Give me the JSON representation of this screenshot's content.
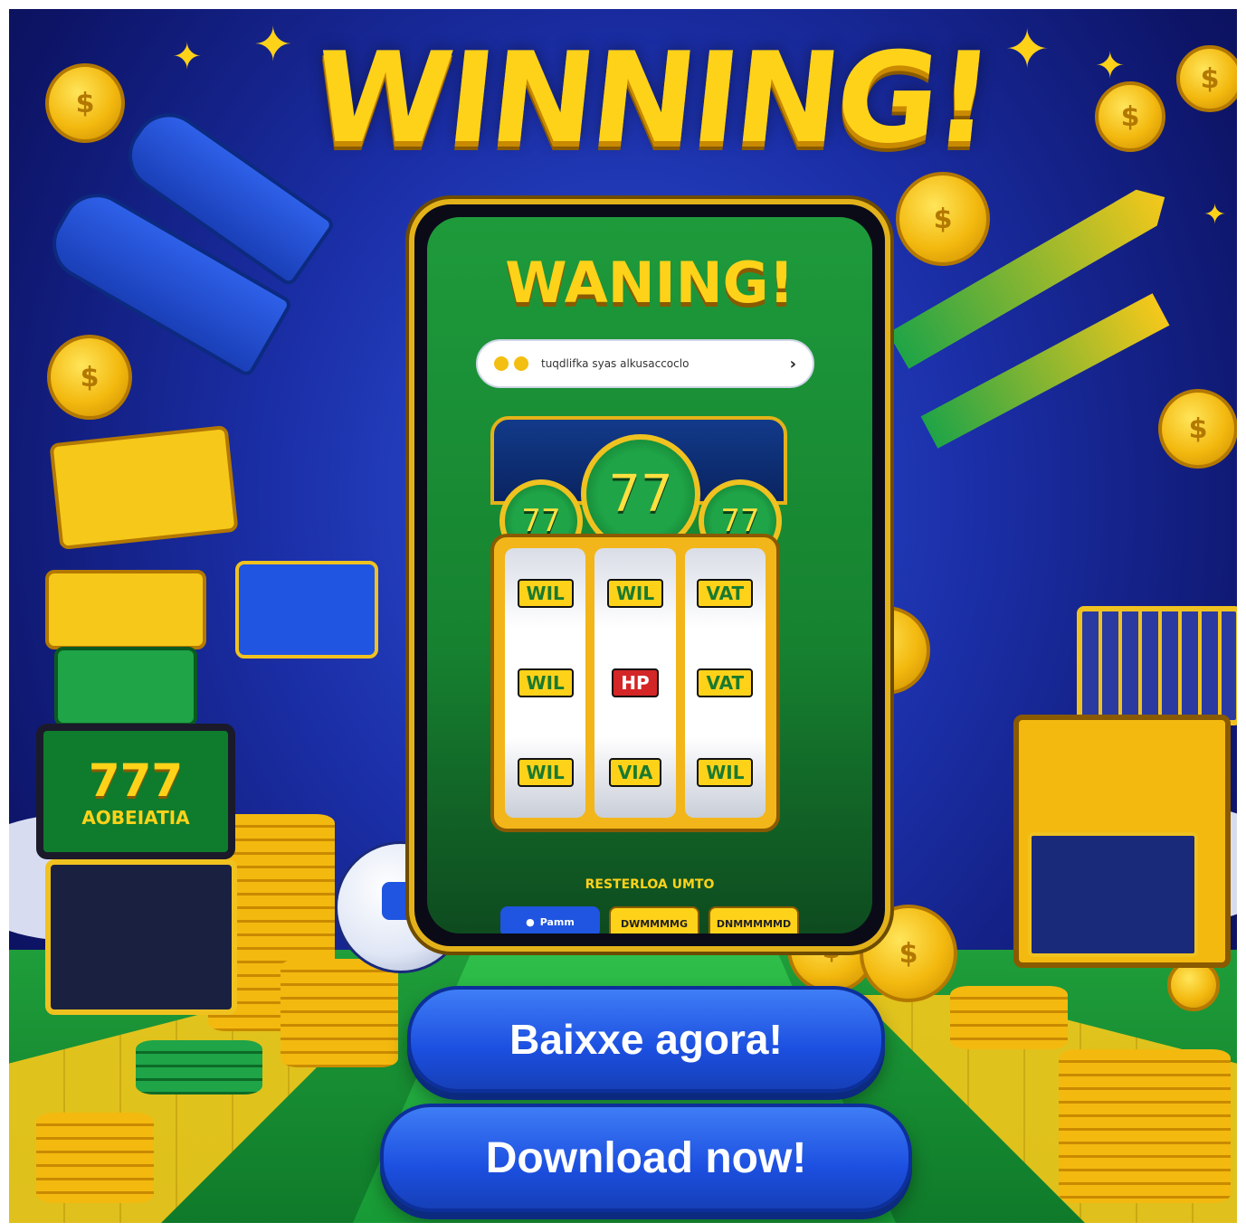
{
  "headline": "WINNING!",
  "phone": {
    "heading": "WANING!",
    "search_text": "tuqdlifka syas alkusaccoclo",
    "center_medal": "77",
    "side_medal_left": "77",
    "side_medal_right": "77",
    "reel_symbols": [
      [
        "WIL",
        "WIL",
        "WIL"
      ],
      [
        "WIL",
        "HP",
        "VIA"
      ],
      [
        "VAT",
        "VAT",
        "WIL"
      ]
    ],
    "footer_text": "RESTERLOA UMTO",
    "pill_apple": "Pamm",
    "pill_mid": "DWMMMMG",
    "pill_right": "DNMMMMMD"
  },
  "left_machine": {
    "display_number": "777",
    "display_sub": "AOBEIATIA"
  },
  "buttons": {
    "primary": "Baixxe agora!",
    "secondary": "Download now!"
  },
  "colors": {
    "gold": "#ffd21a",
    "green": "#1fa447",
    "blue": "#1f55e0",
    "navy": "#0d1466"
  }
}
